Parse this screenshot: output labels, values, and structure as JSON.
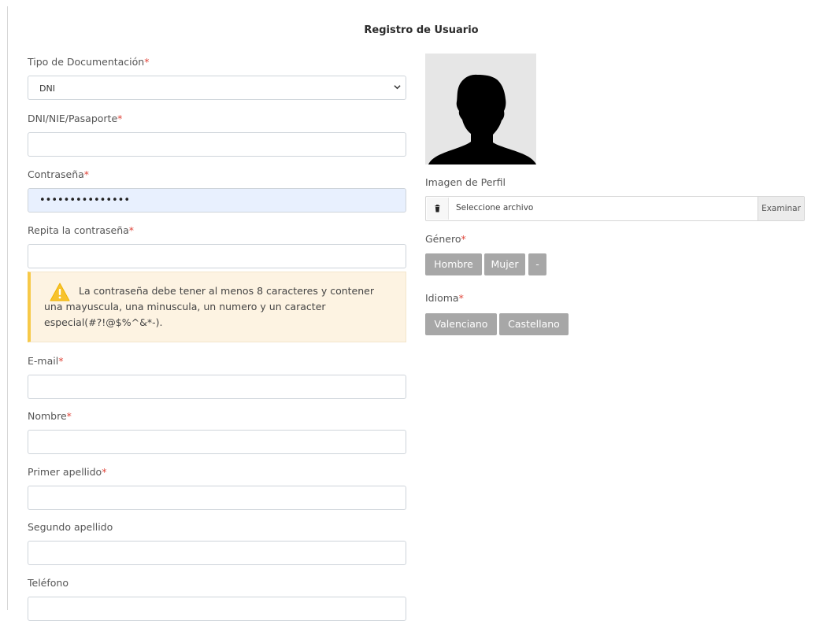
{
  "page_title": "Registro de Usuario",
  "required_mark": "*",
  "form": {
    "doc_type": {
      "label": "Tipo de Documentación",
      "value": "DNI"
    },
    "doc_number": {
      "label": "DNI/NIE/Pasaporte",
      "value": ""
    },
    "password": {
      "label": "Contraseña",
      "value": "•••••••••••••••"
    },
    "password_repeat": {
      "label": "Repita la contraseña",
      "value": ""
    },
    "password_hint": "La contraseña debe tener al menos 8 caracteres y contener una mayuscula, una minuscula, un numero y un caracter especial(#?!@$%^&*-).",
    "email": {
      "label": "E-mail",
      "value": ""
    },
    "first_name": {
      "label": "Nombre",
      "value": ""
    },
    "surname1": {
      "label": "Primer apellido",
      "value": ""
    },
    "surname2": {
      "label": "Segundo apellido",
      "value": ""
    },
    "phone": {
      "label": "Teléfono",
      "value": ""
    }
  },
  "profile": {
    "image_label": "Imagen de Perfil",
    "file_placeholder": "Seleccione archivo",
    "browse_label": "Examinar",
    "gender_label": "Género",
    "gender_options": [
      "Hombre",
      "Mujer",
      "-"
    ],
    "language_label": "Idioma",
    "language_options": [
      "Valenciano",
      "Castellano"
    ]
  },
  "colors": {
    "required": "#e0453a",
    "alert_border": "#f7c948",
    "alert_bg": "#fdf3e2",
    "autofill_bg": "#e8f0fe",
    "button_bg": "#a7a7a7"
  },
  "icons": {
    "select_arrow": "chevron-down-icon",
    "warning": "warning-icon",
    "clear_file": "trash-icon",
    "avatar": "user-silhouette-icon"
  }
}
